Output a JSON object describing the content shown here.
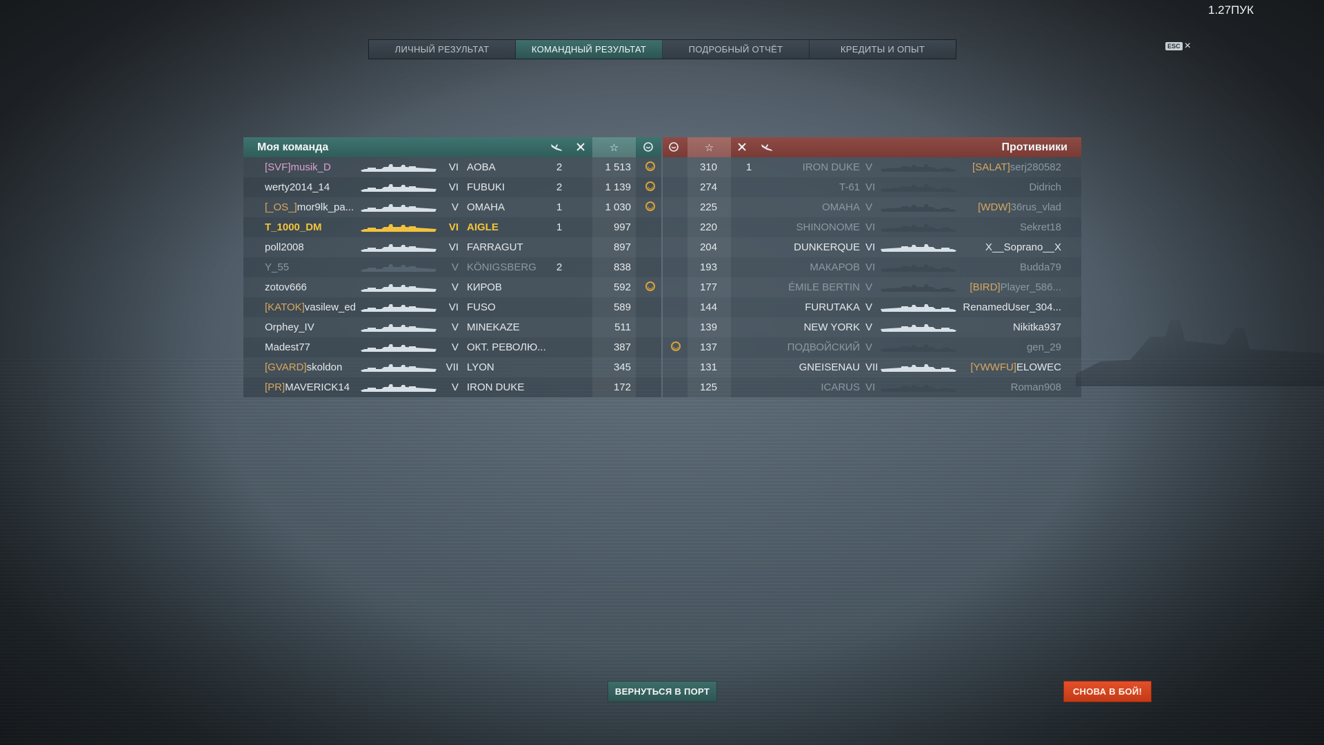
{
  "clock": "1.27ПУК",
  "esc": {
    "key": "ESC",
    "close": "×"
  },
  "tabs": [
    {
      "label": "ЛИЧНЫЙ РЕЗУЛЬТАТ",
      "active": false
    },
    {
      "label": "КОМАНДНЫЙ РЕЗУЛЬТАТ",
      "active": true
    },
    {
      "label": "ПОДРОБНЫЙ ОТЧЁТ",
      "active": false
    },
    {
      "label": "КРЕДИТЫ И ОПЫТ",
      "active": false
    }
  ],
  "my_team": {
    "title": "Моя команда",
    "columns": {
      "planes": "plane-kill-icon",
      "frags": "frag-icon",
      "xp": "☆",
      "medal": "medal-icon"
    },
    "rows": [
      {
        "clan": "[SVF]",
        "name": "musik_D",
        "tier": "VI",
        "ship": "AOBA",
        "frags": "2",
        "xp": "1 513",
        "medal": true,
        "style": "pink"
      },
      {
        "clan": "",
        "name": "werty2014_14",
        "tier": "VI",
        "ship": "FUBUKI",
        "frags": "2",
        "xp": "1 139",
        "medal": true,
        "style": "normal"
      },
      {
        "clan": "[_OS_]",
        "name": "mor9lk_pa...",
        "tier": "V",
        "ship": "OMAHA",
        "frags": "1",
        "xp": "1 030",
        "medal": true,
        "style": "orange"
      },
      {
        "clan": "",
        "name": "T_1000_DM",
        "tier": "VI",
        "ship": "AIGLE",
        "frags": "1",
        "xp": "997",
        "medal": false,
        "style": "me"
      },
      {
        "clan": "",
        "name": "poll2008",
        "tier": "VI",
        "ship": "FARRAGUT",
        "frags": "",
        "xp": "897",
        "medal": false,
        "style": "normal"
      },
      {
        "clan": "",
        "name": "Y_55",
        "tier": "V",
        "ship": "KÖNIGSBERG",
        "frags": "2",
        "xp": "838",
        "medal": false,
        "style": "dead"
      },
      {
        "clan": "",
        "name": "zotov666",
        "tier": "V",
        "ship": "КИРОВ",
        "frags": "",
        "xp": "592",
        "medal": true,
        "style": "normal"
      },
      {
        "clan": "[KATOK]",
        "name": "vasilew_ed",
        "tier": "VI",
        "ship": "FUSO",
        "frags": "",
        "xp": "589",
        "medal": false,
        "style": "normal"
      },
      {
        "clan": "",
        "name": "Orphey_IV",
        "tier": "V",
        "ship": "MINEKAZE",
        "frags": "",
        "xp": "511",
        "medal": false,
        "style": "normal"
      },
      {
        "clan": "",
        "name": "Madest77",
        "tier": "V",
        "ship": "ОКТ. РЕВОЛЮ...",
        "frags": "",
        "xp": "387",
        "medal": false,
        "style": "normal"
      },
      {
        "clan": "[GVARD]",
        "name": "skoldon",
        "tier": "VII",
        "ship": "LYON",
        "frags": "",
        "xp": "345",
        "medal": false,
        "style": "orange"
      },
      {
        "clan": "[PR]",
        "name": "MAVERICK14",
        "tier": "V",
        "ship": "IRON DUKE",
        "frags": "",
        "xp": "172",
        "medal": false,
        "style": "orange"
      }
    ]
  },
  "enemy_team": {
    "title": "Противники",
    "rows": [
      {
        "medal": false,
        "xp": "310",
        "frags": "1",
        "ship": "IRON DUKE",
        "tier": "V",
        "clan": "[SALAT]",
        "name": "serj280582",
        "dead": true
      },
      {
        "medal": false,
        "xp": "274",
        "frags": "",
        "ship": "T-61",
        "tier": "VI",
        "clan": "",
        "name": "Didrich",
        "dead": true
      },
      {
        "medal": false,
        "xp": "225",
        "frags": "",
        "ship": "OMAHA",
        "tier": "V",
        "clan": "[WDW]",
        "name": "36rus_vlad",
        "dead": true
      },
      {
        "medal": false,
        "xp": "220",
        "frags": "",
        "ship": "SHINONOME",
        "tier": "VI",
        "clan": "",
        "name": "Sekret18",
        "dead": true
      },
      {
        "medal": false,
        "xp": "204",
        "frags": "",
        "ship": "DUNKERQUE",
        "tier": "VI",
        "clan": "",
        "name": "X__Soprano__X",
        "dead": false
      },
      {
        "medal": false,
        "xp": "193",
        "frags": "",
        "ship": "МАКАРОВ",
        "tier": "VI",
        "clan": "",
        "name": "Budda79",
        "dead": true
      },
      {
        "medal": false,
        "xp": "177",
        "frags": "",
        "ship": "ÉMILE BERTIN",
        "tier": "V",
        "clan": "[BIRD]",
        "name": "Player_586...",
        "dead": true
      },
      {
        "medal": false,
        "xp": "144",
        "frags": "",
        "ship": "FURUTAKA",
        "tier": "V",
        "clan": "",
        "name": "RenamedUser_304...",
        "dead": false
      },
      {
        "medal": false,
        "xp": "139",
        "frags": "",
        "ship": "NEW YORK",
        "tier": "V",
        "clan": "",
        "name": "Nikitka937",
        "dead": false
      },
      {
        "medal": true,
        "xp": "137",
        "frags": "",
        "ship": "ПОДВОЙСКИЙ",
        "tier": "V",
        "clan": "",
        "name": "gen_29",
        "dead": true
      },
      {
        "medal": false,
        "xp": "131",
        "frags": "",
        "ship": "GNEISENAU",
        "tier": "VII",
        "clan": "[YWWFU]",
        "name": "ELOWEC",
        "dead": false
      },
      {
        "medal": false,
        "xp": "125",
        "frags": "",
        "ship": "ICARUS",
        "tier": "VI",
        "clan": "",
        "name": "Roman908",
        "dead": true
      }
    ]
  },
  "buttons": {
    "port": "ВЕРНУТЬСЯ В ПОРТ",
    "battle": "СНОВА В БОЙ!"
  },
  "colors": {
    "my_team_header": "#3f7470",
    "enemy_header": "#8e4b45",
    "self_highlight": "#f4c53a",
    "battle_button": "#e4502a"
  }
}
